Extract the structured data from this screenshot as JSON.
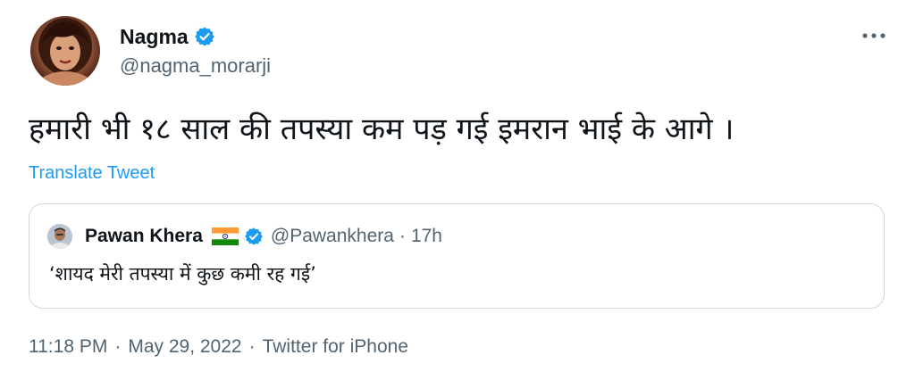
{
  "tweet": {
    "author": {
      "display_name": "Nagma",
      "handle": "@nagma_morarji",
      "verified": true
    },
    "text": "हमारी भी १८ साल की तपस्या कम पड़ गई इमरान भाई के आगे ।",
    "translate_label": "Translate Tweet",
    "quoted": {
      "display_name": "Pawan Khera",
      "flag_icon": "india-flag-icon",
      "verified": true,
      "handle": "@Pawankhera",
      "separator": "·",
      "time": "17h",
      "text": "‘शायद मेरी तपस्या में कुछ कमी रह गई’"
    },
    "meta": {
      "time": "11:18 PM",
      "date": "May 29, 2022",
      "source": "Twitter for iPhone",
      "separator": "·"
    }
  },
  "colors": {
    "text": "#0f1419",
    "secondary": "#536471",
    "accent": "#1d9bf0",
    "border": "#cfd9de"
  }
}
